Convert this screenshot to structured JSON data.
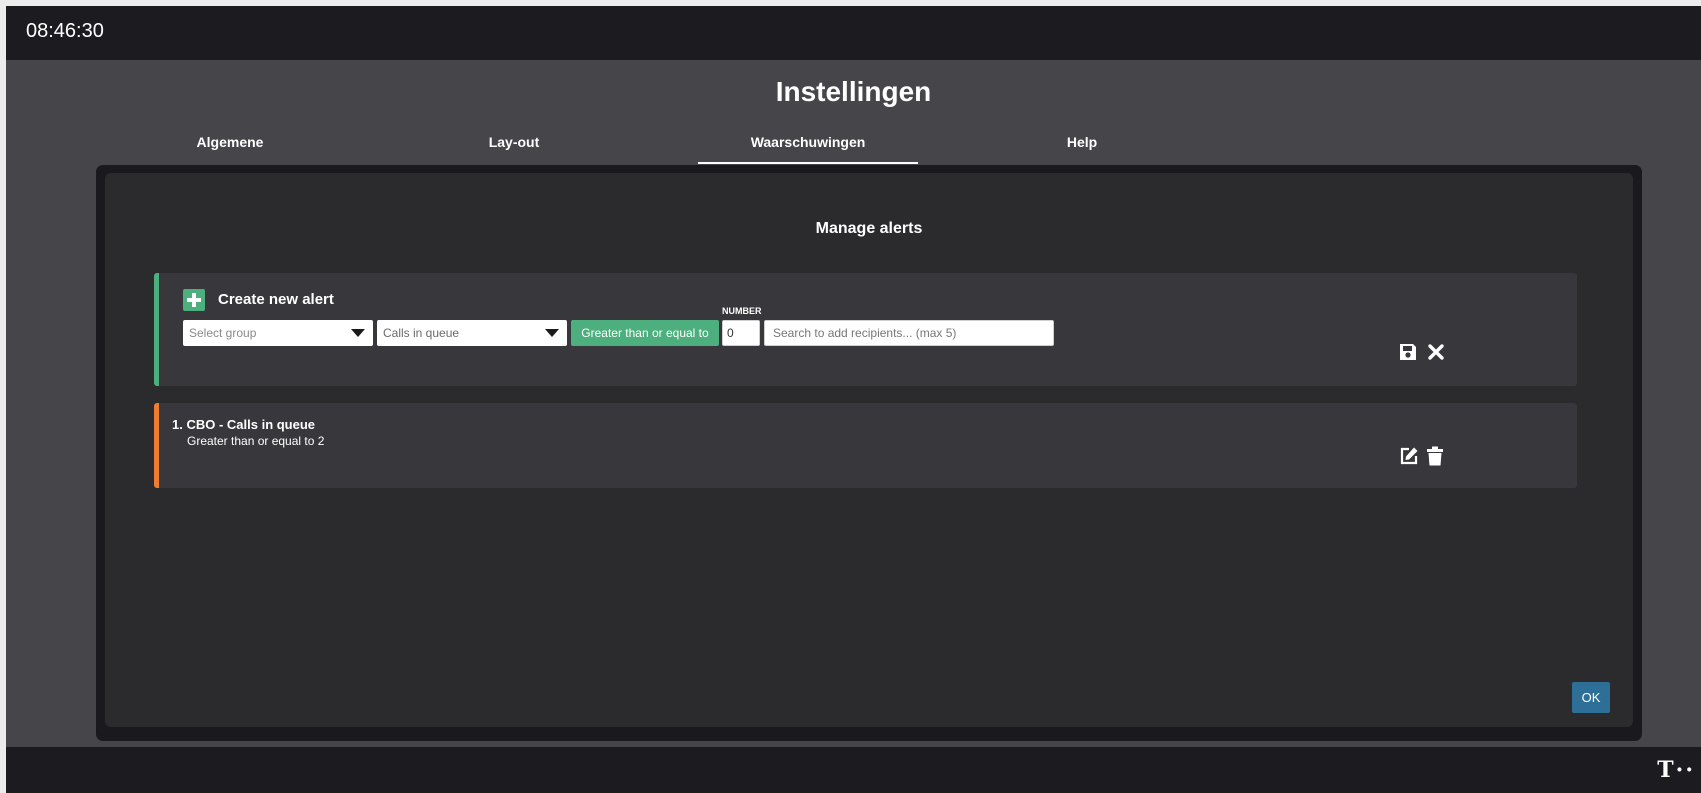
{
  "header": {
    "clock": "08:46:30"
  },
  "page": {
    "title": "Instellingen"
  },
  "tabs": [
    {
      "label": "Algemene",
      "active": false
    },
    {
      "label": "Lay-out",
      "active": false
    },
    {
      "label": "Waarschuwingen",
      "active": true
    },
    {
      "label": "Help",
      "active": false
    }
  ],
  "manage": {
    "title": "Manage alerts",
    "create": {
      "title": "Create new alert",
      "group_select": {
        "value": "Select group"
      },
      "metric_select": {
        "value": "Calls in queue"
      },
      "operator_button": "Greater than or equal to",
      "number_label": "NUMBER",
      "number_value": "0",
      "recipients_placeholder": "Search to add recipients... (max 5)"
    },
    "alerts": [
      {
        "title": "1. CBO - Calls in queue",
        "condition": "Greater than or equal to 2"
      }
    ],
    "ok_label": "OK"
  },
  "footer": {
    "brand": "T··"
  },
  "colors": {
    "accent_green": "#4caf7d",
    "accent_orange": "#ed7d31",
    "ok_blue": "#2e6f98"
  },
  "icons": {
    "create": "plus-icon",
    "save": "save-icon",
    "cancel": "close-icon",
    "edit": "edit-icon",
    "delete": "trash-icon",
    "dropdown": "caret-down-icon"
  }
}
